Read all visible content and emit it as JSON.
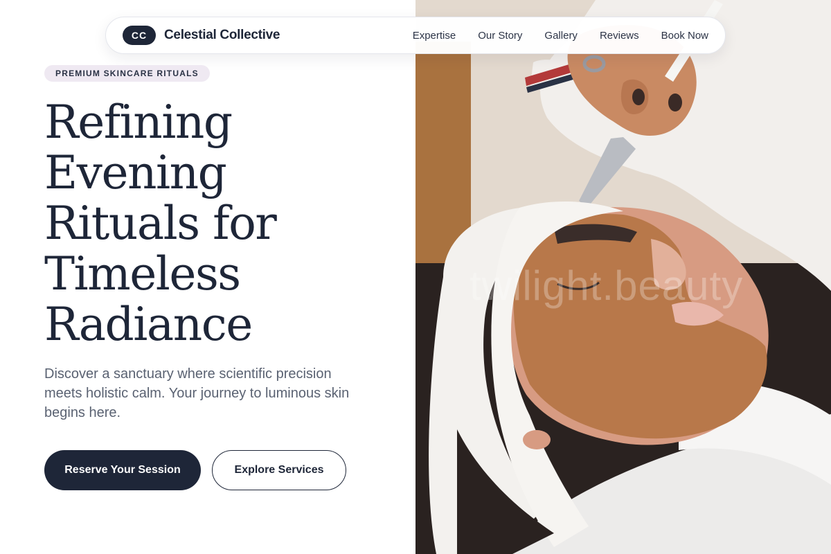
{
  "brand": {
    "logo_text": "CC",
    "name": "Celestial Collective"
  },
  "nav": {
    "links": [
      "Expertise",
      "Our Story",
      "Gallery",
      "Reviews",
      "Book Now"
    ]
  },
  "hero": {
    "badge": "PREMIUM SKINCARE RITUALS",
    "headline": [
      "Refining",
      "Evening",
      "Rituals for",
      "Timeless",
      "Radiance"
    ],
    "subtext": "Discover a sanctuary where scientific precision meets holistic calm. Your journey to luminous skin begins here.",
    "primary_cta": "Reserve Your Session",
    "secondary_cta": "Explore Services"
  },
  "photo": {
    "watermark": "twilight.beauty"
  },
  "colors": {
    "navy": "#1e2638",
    "badge_bg": "#efe9f2",
    "body_text": "#5a6272",
    "mask_clay": "#b8784a"
  }
}
